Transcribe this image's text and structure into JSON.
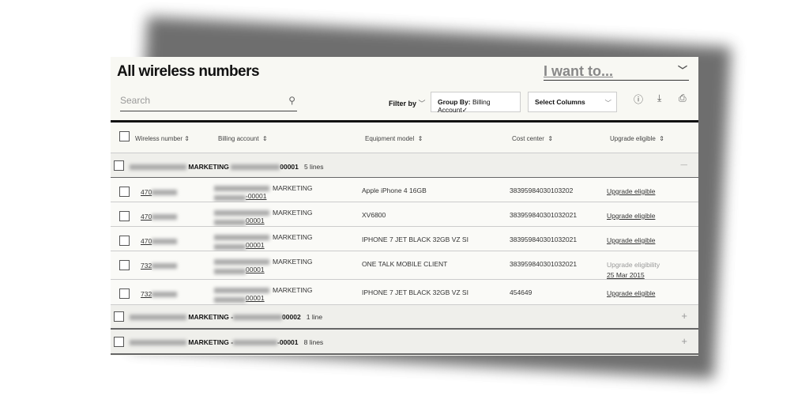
{
  "header": {
    "title": "All wireless numbers",
    "i_want_to": "I want to...",
    "search_placeholder": "Search",
    "filter_by": "Filter by",
    "group_by_label": "Group By:",
    "group_by_value": "Billing Account",
    "select_columns": "Select Columns"
  },
  "columns": [
    "Wireless number",
    "Billing account",
    "Equipment model",
    "Cost center",
    "Upgrade eligible"
  ],
  "groups": [
    {
      "name": "MARKETING",
      "suffix": "00001",
      "count": "5 lines",
      "expanded": true,
      "toggle": "—"
    },
    {
      "name": "MARKETING -",
      "suffix": "00002",
      "count": "1 line",
      "expanded": false,
      "toggle": "+"
    },
    {
      "name": "MARKETING -",
      "suffix": "-00001",
      "count": "8 lines",
      "expanded": false,
      "toggle": "+"
    }
  ],
  "rows": [
    {
      "number": "470",
      "account_name": "MARKETING",
      "account_suffix": "-00001",
      "equipment": "Apple iPhone 4 16GB",
      "cost_center": "38395984030103202",
      "upgrade": "Upgrade eligible",
      "upgrade_date": ""
    },
    {
      "number": "470",
      "account_name": "MARKETING",
      "account_suffix": "00001",
      "equipment": "XV6800",
      "cost_center": "383959840301032021",
      "upgrade": "Upgrade eligible",
      "upgrade_date": ""
    },
    {
      "number": "470",
      "account_name": "MARKETING",
      "account_suffix": "00001",
      "equipment": "IPHONE 7 JET BLACK 32GB VZ SI",
      "cost_center": "383959840301032021",
      "upgrade": "Upgrade eligible",
      "upgrade_date": ""
    },
    {
      "number": "732",
      "account_name": "MARKETING",
      "account_suffix": "00001",
      "equipment": "ONE TALK MOBILE CLIENT",
      "cost_center": "383959840301032021",
      "upgrade": "Upgrade eligibility",
      "upgrade_date": "25 Mar 2015"
    },
    {
      "number": "732",
      "account_name": "MARKETING",
      "account_suffix": "00001",
      "equipment": "IPHONE 7 JET BLACK 32GB VZ SI",
      "cost_center": "454649",
      "upgrade": "Upgrade eligible",
      "upgrade_date": ""
    }
  ]
}
